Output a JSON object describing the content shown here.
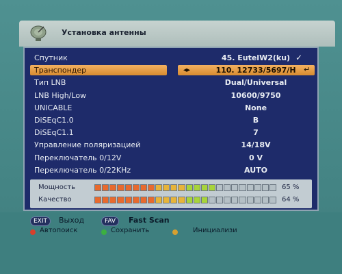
{
  "header": {
    "title": "Установка антенны",
    "icon": "satellite-dish-icon"
  },
  "settings": [
    {
      "label": "Спутник",
      "value": "45. EutelW2(ku)",
      "selected": false,
      "icon": "check-icon"
    },
    {
      "label": "Транспондер",
      "value": "110. 12733/5697/H",
      "selected": true
    },
    {
      "label": "Тип LNB",
      "value": "Dual/Universal",
      "selected": false
    },
    {
      "label": "LNB High/Low",
      "value": "10600/9750",
      "selected": false
    },
    {
      "label": "UNICABLE",
      "value": "None",
      "selected": false
    },
    {
      "label": "DiSEqC1.0",
      "value": "B",
      "selected": false
    },
    {
      "label": "DiSEqC1.1",
      "value": "7",
      "selected": false
    },
    {
      "label": "Управление поляризацией",
      "value": "14/18V",
      "selected": false
    },
    {
      "label": "Переключатель 0/12V",
      "value": "0 V",
      "selected": false
    },
    {
      "label": "Переключатель 0/22KHz",
      "value": "AUTO",
      "selected": false
    }
  ],
  "signal": {
    "strength": {
      "label": "Мощность",
      "percent_text": "65 %",
      "level": 0.65
    },
    "quality": {
      "label": "Качество",
      "percent_text": "64 %",
      "level": 0.64
    }
  },
  "footer": {
    "exit_key": "EXIT",
    "exit_label": "Выход",
    "fav_key": "FAV",
    "fav_label": "Fast Scan",
    "red_label": "Автопоиск",
    "green_label": "Сохранить",
    "yellow_label": "Инициализи"
  },
  "colors": {
    "panel_bg": "#1e2b6a",
    "highlight": "#e39a40",
    "red": "#d8402c",
    "green": "#3cb040",
    "yellow": "#d6a030"
  }
}
